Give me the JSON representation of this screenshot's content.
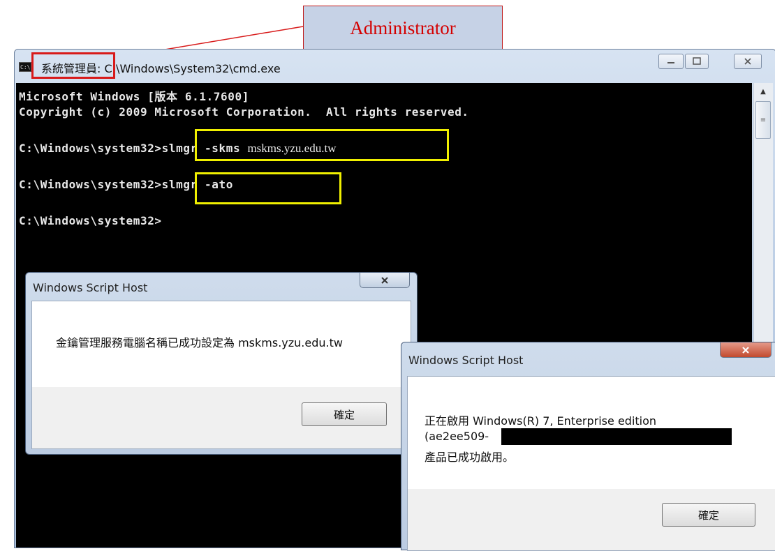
{
  "annotation": {
    "callout_label": "Administrator"
  },
  "cmd_window": {
    "title_highlighted": "系統管理員:",
    "title_rest": " C:\\Windows\\System32\\cmd.exe",
    "icon_label": "C:\\"
  },
  "console": {
    "line1": "Microsoft Windows [版本 6.1.7600]",
    "line2": "Copyright (c) 2009 Microsoft Corporation.  All rights reserved.",
    "prompt": "C:\\Windows\\system32>",
    "cmd1": "slmgr -skms ",
    "cmd1_arg": "mskms.yzu.edu.tw",
    "cmd2": "slmgr -ato"
  },
  "dialog1": {
    "title": "Windows Script Host",
    "message": "金鑰管理服務電腦名稱已成功設定為 mskms.yzu.edu.tw",
    "ok": "確定"
  },
  "dialog2": {
    "title": "Windows Script Host",
    "message_line1": "正在啟用 Windows(R) 7, Enterprise edition",
    "message_line2": "(ae2ee509-",
    "message_line3": "產品已成功啟用。",
    "ok": "確定"
  },
  "colors": {
    "highlight_red": "#d81a1a",
    "highlight_yellow": "#f0ef00",
    "console_bg": "#000000"
  }
}
